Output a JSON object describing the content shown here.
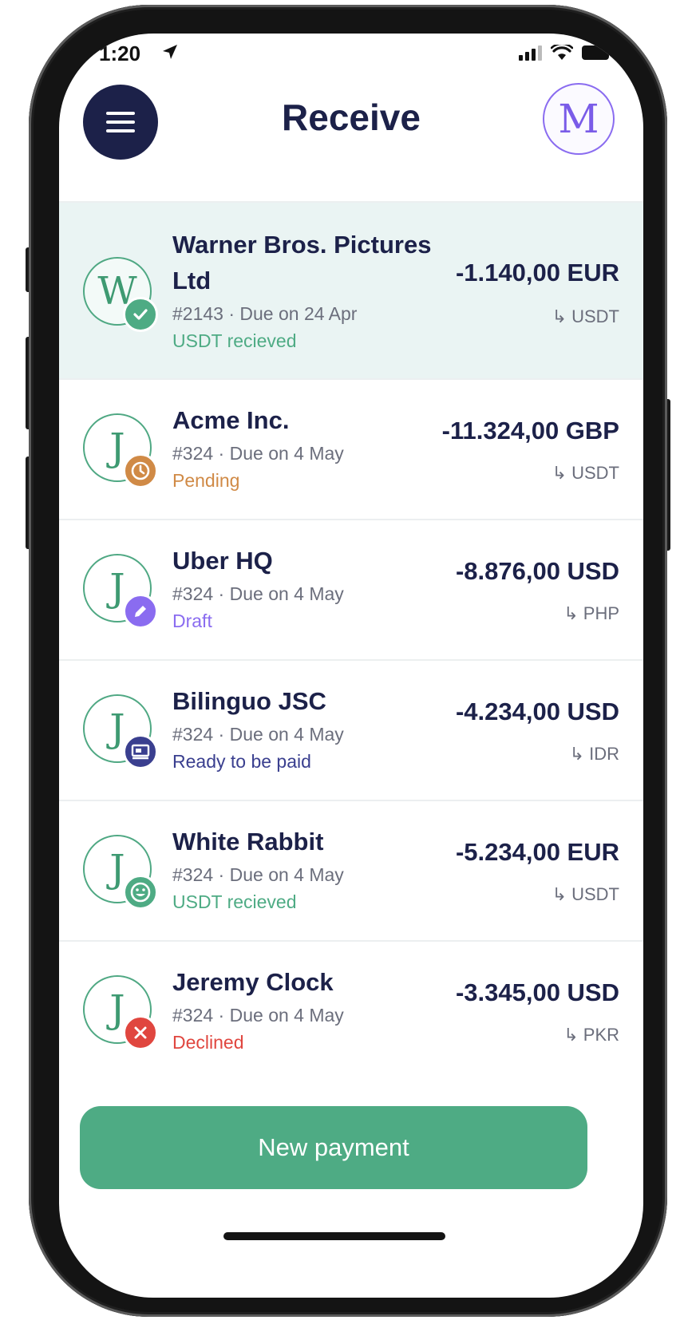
{
  "status_bar": {
    "time": "1:20"
  },
  "header": {
    "title": "Receive",
    "profile_initial": "M"
  },
  "colors": {
    "accent_green": "#4eab84",
    "navy": "#1c2149",
    "pending": "#d08a46",
    "draft": "#8a6cf0",
    "ready": "#3a3f8f",
    "declined": "#e0463f"
  },
  "payments": [
    {
      "initial": "W",
      "name_line1": "Warner Bros. Pictures",
      "name_line2": "Ltd",
      "meta": "#2143 · Due on 24 Apr",
      "status": "USDT recieved",
      "status_icon": "check-icon",
      "amount": "-1.140,00 EUR",
      "conversion": "↳ USDT"
    },
    {
      "initial": "J",
      "name": "Acme Inc.",
      "meta": "#324 · Due on 4 May",
      "status": "Pending",
      "status_icon": "clock-icon",
      "amount": "-11.324,00 GBP",
      "conversion": "↳ USDT"
    },
    {
      "initial": "J",
      "name": "Uber HQ",
      "meta": "#324 · Due on 4 May",
      "status": "Draft",
      "status_icon": "pencil-icon",
      "amount": "-8.876,00 USD",
      "conversion": "↳ PHP"
    },
    {
      "initial": "J",
      "name": "Bilinguo JSC",
      "meta": "#324 · Due on 4 May",
      "status": "Ready to be paid",
      "status_icon": "cash-icon",
      "amount": "-4.234,00 USD",
      "conversion": "↳ IDR"
    },
    {
      "initial": "J",
      "name": "White Rabbit",
      "meta": "#324 · Due on 4 May",
      "status": "USDT recieved",
      "status_icon": "smiley-icon",
      "amount": "-5.234,00 EUR",
      "conversion": "↳ USDT"
    },
    {
      "initial": "J",
      "name": "Jeremy Clock",
      "meta": "#324 · Due on 4 May",
      "status": "Declined",
      "status_icon": "x-icon",
      "amount": "-3.345,00 USD",
      "conversion": "↳ PKR"
    }
  ],
  "footer": {
    "button_label": "New payment"
  }
}
